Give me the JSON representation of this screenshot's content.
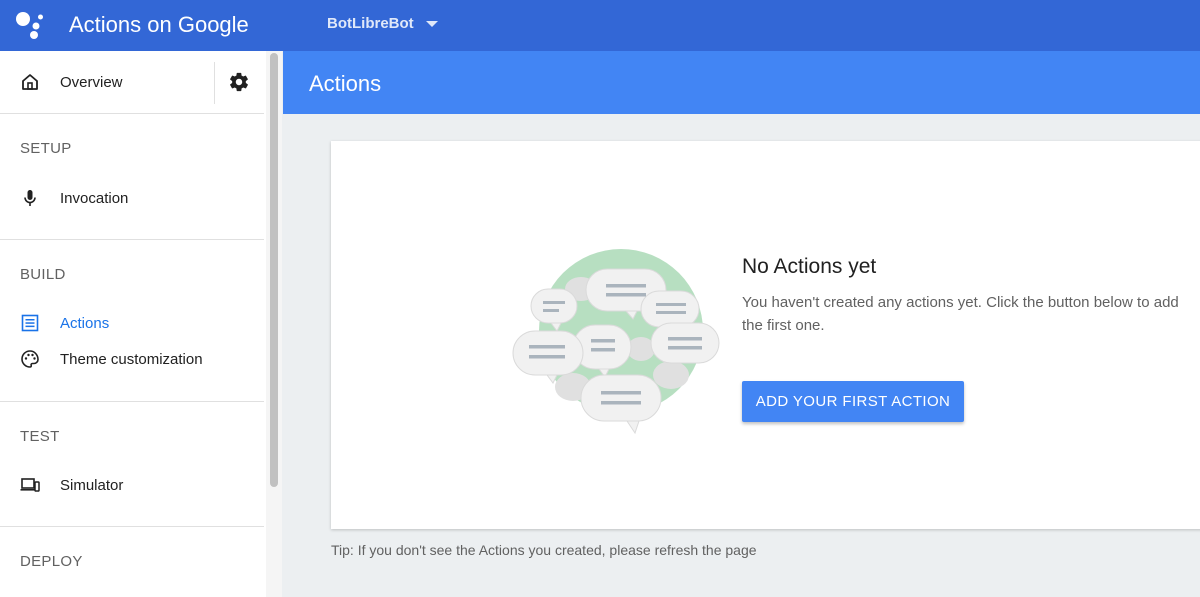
{
  "topbar": {
    "app_title": "Actions on Google",
    "project_name": "BotLibreBot"
  },
  "sidebar": {
    "overview_label": "Overview",
    "sections": [
      {
        "title": "SETUP",
        "items": [
          {
            "label": "Invocation"
          }
        ]
      },
      {
        "title": "BUILD",
        "items": [
          {
            "label": "Actions",
            "active": true
          },
          {
            "label": "Theme customization"
          }
        ]
      },
      {
        "title": "TEST",
        "items": [
          {
            "label": "Simulator"
          }
        ]
      },
      {
        "title": "DEPLOY",
        "items": []
      }
    ]
  },
  "main": {
    "page_title": "Actions",
    "empty_state": {
      "title": "No Actions yet",
      "description": "You haven't created any actions yet. Click the button below to add the first one.",
      "button_label": "ADD YOUR FIRST ACTION"
    },
    "tip": "Tip: If you don't see the Actions you created, please refresh the page"
  },
  "colors": {
    "topbar": "#3367d6",
    "header": "#4285f4",
    "accent": "#1a73e8",
    "background": "#eceff1"
  }
}
